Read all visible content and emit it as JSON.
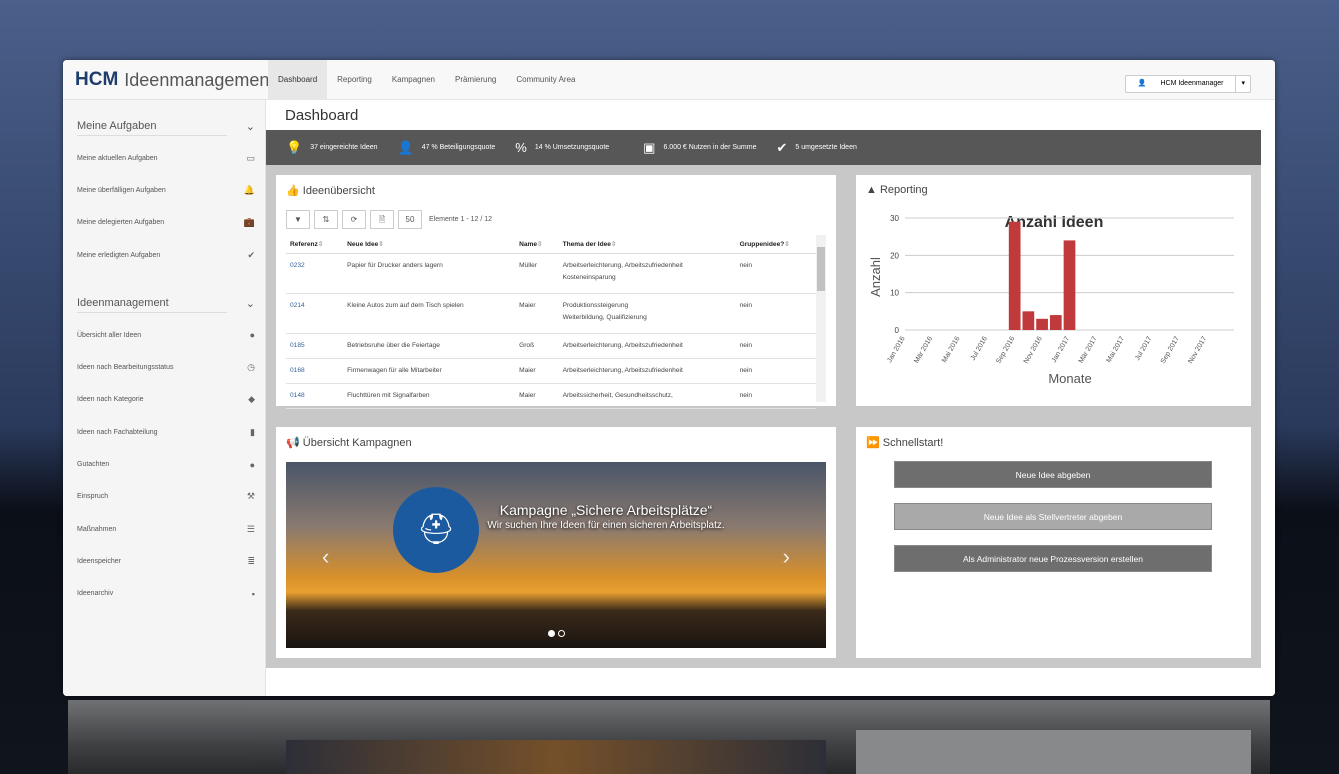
{
  "app": {
    "logo": "HCM",
    "title": "Ideenmanagement"
  },
  "nav": [
    "Dashboard",
    "Reporting",
    "Kampagnen",
    "Prämierung",
    "Community Area"
  ],
  "user": {
    "label": "HCM Ideenmanager",
    "caret": "▾"
  },
  "sidebar": {
    "sections": [
      {
        "title": "Meine Aufgaben",
        "items": [
          {
            "label": "Meine aktuellen Aufgaben",
            "icon": "inbox-icon"
          },
          {
            "label": "Meine überfälligen Aufgaben",
            "icon": "bell-icon"
          },
          {
            "label": "Meine delegierten Aufgaben",
            "icon": "briefcase-icon"
          },
          {
            "label": "Meine erledigten Aufgaben",
            "icon": "check-icon"
          }
        ]
      },
      {
        "title": "Ideenmanagement",
        "items": [
          {
            "label": "Übersicht aller Ideen",
            "icon": "globe-icon"
          },
          {
            "label": "Ideen nach Bearbeitungsstatus",
            "icon": "clock-icon"
          },
          {
            "label": "Ideen nach Kategorie",
            "icon": "tags-icon"
          },
          {
            "label": "Ideen nach Fachabteilung",
            "icon": "building-icon"
          },
          {
            "label": "Gutachten",
            "icon": "circle-icon"
          },
          {
            "label": "Einspruch",
            "icon": "gavel-icon"
          },
          {
            "label": "Maßnahmen",
            "icon": "list-icon"
          },
          {
            "label": "Ideenspeicher",
            "icon": "database-icon"
          },
          {
            "label": "Ideenarchiv",
            "icon": "archive-icon"
          }
        ]
      }
    ]
  },
  "page_title": "Dashboard",
  "stats": [
    {
      "icon": "lightbulb-icon",
      "text": "37 eingereichte Ideen"
    },
    {
      "icon": "user-icon",
      "text": "47 % Beteiligungsquote"
    },
    {
      "icon": "percent-icon",
      "text": "14 % Umsetzungsquote"
    },
    {
      "icon": "money-icon",
      "text": "6.000 € Nutzen in der Summe"
    },
    {
      "icon": "check-icon",
      "text": "5 umgesetzte Ideen"
    }
  ],
  "ideas": {
    "title": "Ideenübersicht",
    "page_size": "50",
    "count": "Elemente 1 - 12 / 12",
    "columns": [
      "Referenz",
      "Neue Idee",
      "Name",
      "Thema der Idee",
      "Gruppenidee?"
    ],
    "rows": [
      [
        "0232",
        "Papier für Drucker anders lagern",
        "Müller",
        "Arbeitserleichterung, Arbeitszufriedenheit\nKosteneinsparung",
        "nein"
      ],
      [
        "0214",
        "Kleine Autos zum auf dem Tisch spielen",
        "Maier",
        "Produktionssteigerung\nWeiterbildung, Qualifizierung",
        "nein"
      ],
      [
        "0185",
        "Betriebsruhe über die Feiertage",
        "Groß",
        "Arbeitserleichterung, Arbeitszufriedenheit",
        "nein"
      ],
      [
        "0168",
        "Firmenwagen für alle Mitarbeiter",
        "Maier",
        "Arbeitserleichterung, Arbeitszufriedenheit",
        "nein"
      ],
      [
        "0148",
        "Fluchttüren mit Signalfarben",
        "Maier",
        "Arbeitssicherheit, Gesundheitsschutz,",
        "nein"
      ]
    ]
  },
  "reporting": {
    "title": "Reporting"
  },
  "chart_data": {
    "type": "bar",
    "title": "Anzahl Ideen",
    "xlabel": "Monate",
    "ylabel": "Anzahl",
    "ylim": [
      0,
      30
    ],
    "yticks": [
      0,
      10,
      20,
      30
    ],
    "tick_labels": [
      "Jan 2016",
      "Mär 2016",
      "Mai 2016",
      "Jul 2016",
      "Sep 2016",
      "Nov 2016",
      "Jan 2017",
      "Mär 2017",
      "Mai 2017",
      "Jul 2017",
      "Sep 2017",
      "Nov 2017"
    ],
    "categories": [
      "Sep 2016",
      "Okt 2016",
      "Nov 2016",
      "Dez 2016",
      "Jan 2017"
    ],
    "month_index": [
      8,
      9,
      10,
      11,
      12
    ],
    "values": [
      29,
      5,
      3,
      4,
      24
    ],
    "color": "#c0393b",
    "grid": true
  },
  "campaigns": {
    "title": "Übersicht Kampagnen",
    "slide_title": "Kampagne „Sichere Arbeitsplätze“",
    "slide_text": "Wir suchen Ihre Ideen für einen sicheren Arbeitsplatz."
  },
  "quickstart": {
    "title": "Schnellstart!",
    "buttons": [
      "Neue Idee abgeben",
      "Neue Idee als Stellvertreter abgeben",
      "Als Administrator neue Prozessversion erstellen"
    ]
  }
}
